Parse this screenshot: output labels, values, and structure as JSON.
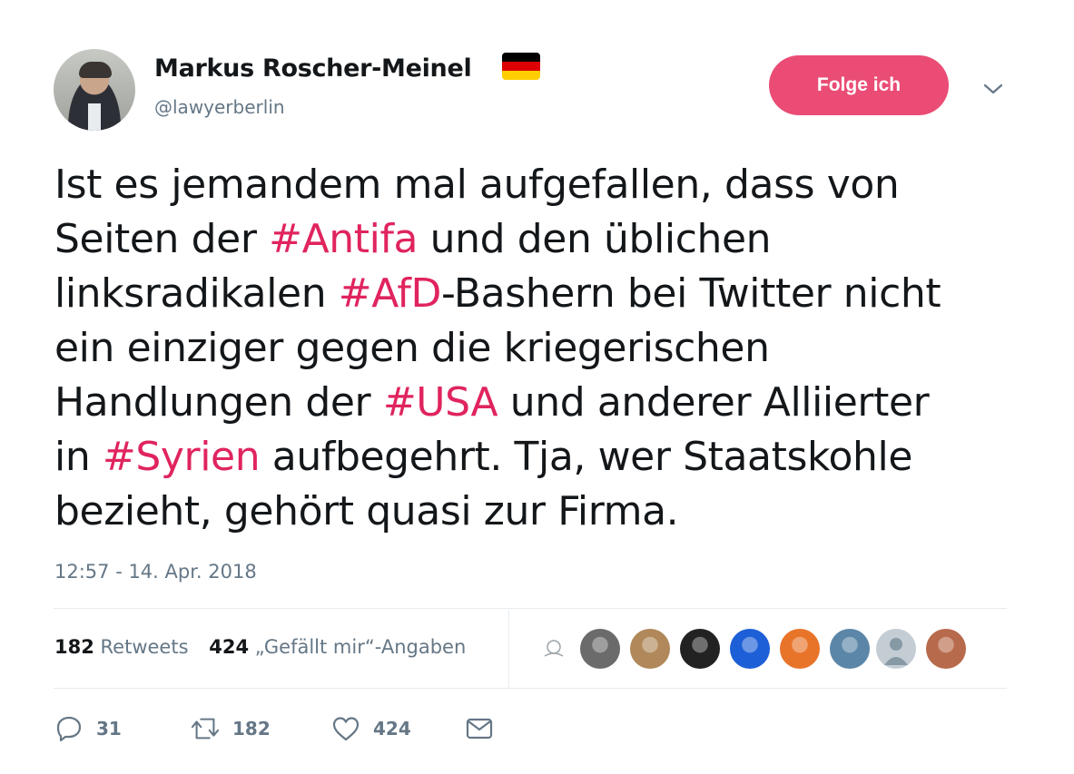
{
  "author": {
    "name": "Markus Roscher-Meinel",
    "handle": "@lawyerberlin",
    "flag_colors": [
      "#000000",
      "#dd0000",
      "#ffce00"
    ]
  },
  "follow_button": {
    "label": "Folge ich"
  },
  "tweet": {
    "lines": [
      [
        {
          "t": "Ist es jemandem mal aufgefallen, dass von",
          "tag": false
        }
      ],
      [
        {
          "t": "Seiten der ",
          "tag": false
        },
        {
          "t": "#Antifa",
          "tag": true
        },
        {
          "t": " und den üblichen",
          "tag": false
        }
      ],
      [
        {
          "t": "linksradikalen ",
          "tag": false
        },
        {
          "t": "#AfD",
          "tag": true
        },
        {
          "t": "-Bashern bei Twitter nicht",
          "tag": false
        }
      ],
      [
        {
          "t": "ein einziger gegen die kriegerischen",
          "tag": false
        }
      ],
      [
        {
          "t": "Handlungen der ",
          "tag": false
        },
        {
          "t": "#USA",
          "tag": true
        },
        {
          "t": " und anderer Alliierter",
          "tag": false
        }
      ],
      [
        {
          "t": "in ",
          "tag": false
        },
        {
          "t": "#Syrien",
          "tag": true
        },
        {
          "t": " aufbegehrt. Tja, wer Staatskohle",
          "tag": false
        }
      ],
      [
        {
          "t": "bezieht, gehört quasi zur Firma.",
          "tag": false
        }
      ]
    ],
    "timestamp": "12:57 - 14. Apr. 2018"
  },
  "stats": {
    "retweets_count": "182",
    "retweets_label": "Retweets",
    "likes_count": "424",
    "likes_label": "„Gefällt mir“-Angaben"
  },
  "likers": [
    {
      "icon": "sketch-avatar"
    },
    {
      "icon": "man-bw-avatar",
      "color": "#6b6b6b"
    },
    {
      "icon": "man-suit-avatar",
      "color": "#b0885a"
    },
    {
      "icon": "dark-avatar",
      "color": "#222222"
    },
    {
      "icon": "blue-planet-avatar",
      "color": "#1d5fd6"
    },
    {
      "icon": "fire-avatar",
      "color": "#e8742a"
    },
    {
      "icon": "bird-avatar",
      "color": "#5b86a8"
    },
    {
      "icon": "default-avatar",
      "color": "#c4ccd4"
    },
    {
      "icon": "brick-avatar",
      "color": "#b86a4c"
    }
  ],
  "actions": {
    "reply_count": "31",
    "retweet_count": "182",
    "like_count": "424"
  },
  "colors": {
    "accent": "#e0245e",
    "muted": "#657786",
    "text": "#14171a"
  }
}
